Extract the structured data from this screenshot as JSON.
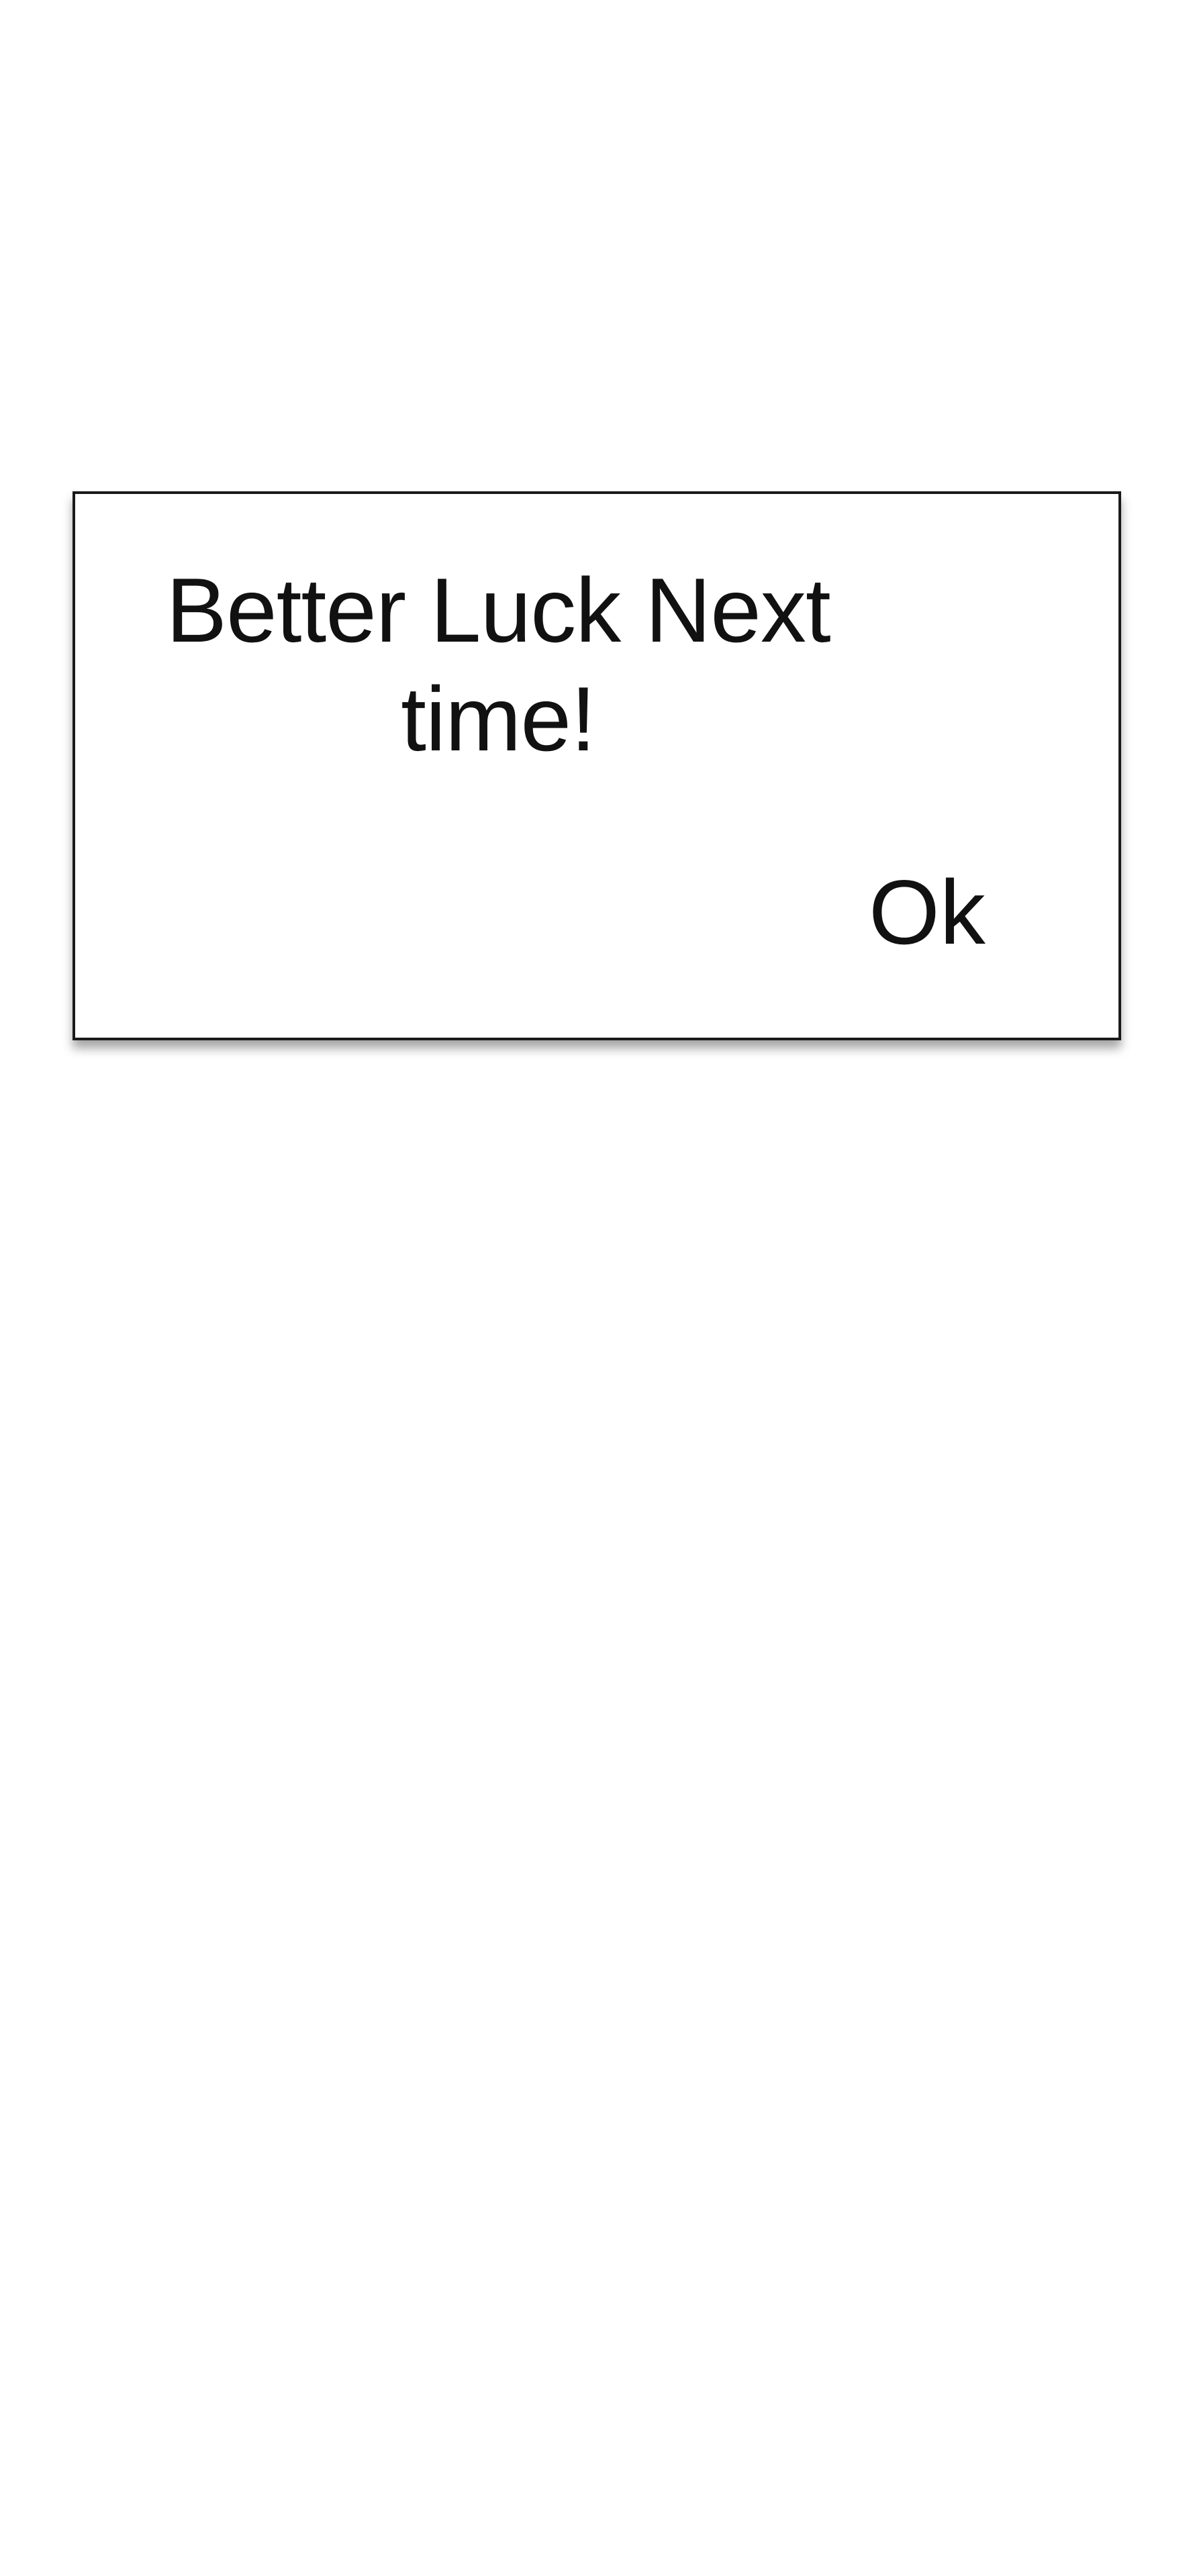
{
  "dialog": {
    "message": "Better Luck Next time!",
    "ok_label": "Ok"
  }
}
